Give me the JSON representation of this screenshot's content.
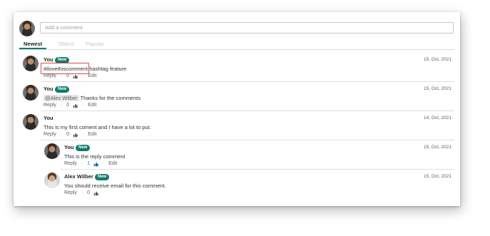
{
  "composer": {
    "placeholder": "Add a comment"
  },
  "tabs": [
    {
      "label": "Newest"
    },
    {
      "label": "Oldest"
    },
    {
      "label": "Popular"
    }
  ],
  "comments": [
    {
      "author": "You",
      "badge": "New",
      "date": "15, Oct, 2021",
      "body_hashtag": "#ilovethiscomment",
      "body_text": " hashtag feature",
      "reply": "Reply",
      "likes": "0",
      "edit": "Edit"
    },
    {
      "author": "You",
      "badge": "New",
      "date": "15, Oct, 2021",
      "mention": "@Alex Wilber",
      "body_text": " Thanks for the comments",
      "reply": "Reply",
      "likes": "0",
      "edit": "Edit"
    },
    {
      "author": "You",
      "date": "14, Oct, 2021",
      "body_text": "This is my first coment and I have a lot to put.",
      "reply": "Reply",
      "likes": "0",
      "edit": "Edit"
    },
    {
      "author": "You",
      "badge": "New",
      "date": "15, Oct, 2021",
      "body_text": "This is the reply comment",
      "reply": "Reply",
      "likes": "1",
      "edit": "Edit"
    },
    {
      "author": "Alex Wilber",
      "badge": "New",
      "date": "15, Oct, 2021",
      "body_text": "You should receive email for this comment.",
      "reply": "Reply",
      "likes": "0"
    }
  ],
  "colors": {
    "accent": "#0f7b6c",
    "highlight": "#e04a55",
    "liked": "#0f6cbd"
  }
}
